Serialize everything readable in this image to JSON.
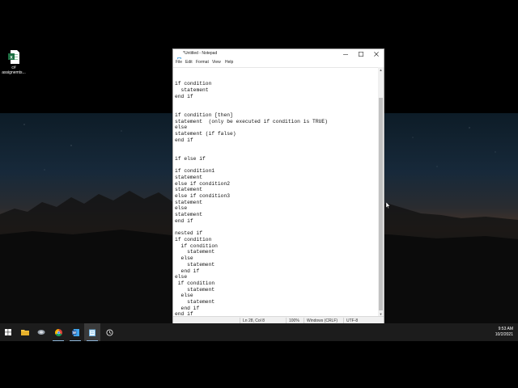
{
  "desktop": {
    "icons": [
      {
        "label": "c# assignemts..."
      }
    ]
  },
  "notepad": {
    "title": "*Untitled - Notepad",
    "menu": [
      "File",
      "Edit",
      "Format",
      "View",
      "Help"
    ],
    "content": "\n\nif condition\n  statement\nend if\n\n\nif condition [then]\nstatement  (only be executed if condition is TRUE)\nelse\nstatement (if false)\nend if\n\n\nif else if\n\nif condition1\nstatement\nelse if condition2\nstatement\nelse if condition3\nstatement\nelse\nstatement\nend if\n\nnested if\nif condition\n  if condition\n    statement\n  else\n    statement\n  end if\nelse\n if condition\n    statement\n  else\n    statement\n  end if\nend if",
    "status": {
      "position": "Ln 28, Col 8",
      "zoom": "100%",
      "line_ending": "Windows (CRLF)",
      "encoding": "UTF-8"
    }
  },
  "taskbar": {
    "items": [
      "start-button",
      "file-explorer",
      "taskbar-app",
      "chrome",
      "word",
      "notepad",
      "settings"
    ],
    "active": "notepad",
    "clock": {
      "time": "9:53 AM",
      "date": "10/2/2021"
    }
  },
  "colors": {
    "taskbar": "#1c1c1c",
    "accent": "#0078d7",
    "excel_green": "#1d6f42",
    "word_blue": "#2b579a"
  }
}
